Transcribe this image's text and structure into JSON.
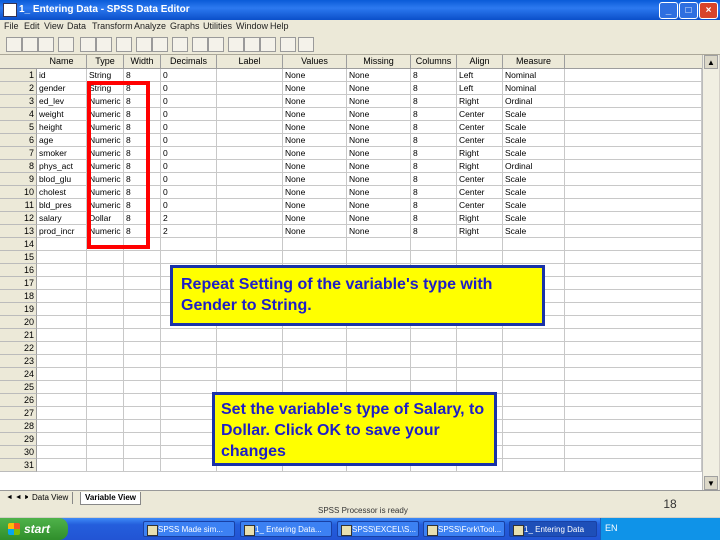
{
  "window": {
    "title": "1_ Entering Data - SPSS Data Editor"
  },
  "menu": [
    "File",
    "Edit",
    "View",
    "Data",
    "Transform",
    "Analyze",
    "Graphs",
    "Utilities",
    "Window",
    "Help"
  ],
  "grid": {
    "columns": [
      "Name",
      "Type",
      "Width",
      "Decimals",
      "Label",
      "Values",
      "Missing",
      "Columns",
      "Align",
      "Measure"
    ],
    "rows": [
      [
        "id",
        "String",
        "8",
        "0",
        "",
        "None",
        "None",
        "8",
        "Left",
        "Nominal"
      ],
      [
        "gender",
        "String",
        "8",
        "0",
        "",
        "None",
        "None",
        "8",
        "Left",
        "Nominal"
      ],
      [
        "ed_lev",
        "Numeric",
        "8",
        "0",
        "",
        "None",
        "None",
        "8",
        "Right",
        "Ordinal"
      ],
      [
        "weight",
        "Numeric",
        "8",
        "0",
        "",
        "None",
        "None",
        "8",
        "Center",
        "Scale"
      ],
      [
        "height",
        "Numeric",
        "8",
        "0",
        "",
        "None",
        "None",
        "8",
        "Center",
        "Scale"
      ],
      [
        "age",
        "Numeric",
        "8",
        "0",
        "",
        "None",
        "None",
        "8",
        "Center",
        "Scale"
      ],
      [
        "smoker",
        "Numeric",
        "8",
        "0",
        "",
        "None",
        "None",
        "8",
        "Right",
        "Scale"
      ],
      [
        "phys_act",
        "Numeric",
        "8",
        "0",
        "",
        "None",
        "None",
        "8",
        "Right",
        "Ordinal"
      ],
      [
        "blod_glu",
        "Numeric",
        "8",
        "0",
        "",
        "None",
        "None",
        "8",
        "Center",
        "Scale"
      ],
      [
        "cholest",
        "Numeric",
        "8",
        "0",
        "",
        "None",
        "None",
        "8",
        "Center",
        "Scale"
      ],
      [
        "bld_pres",
        "Numeric",
        "8",
        "0",
        "",
        "None",
        "None",
        "8",
        "Center",
        "Scale"
      ],
      [
        "salary",
        "Dollar",
        "8",
        "2",
        "",
        "None",
        "None",
        "8",
        "Right",
        "Scale"
      ],
      [
        "prod_incr",
        "Numeric",
        "8",
        "2",
        "",
        "None",
        "None",
        "8",
        "Right",
        "Scale"
      ]
    ],
    "row_numbers": [
      "1",
      "2",
      "3",
      "4",
      "5",
      "6",
      "7",
      "8",
      "9",
      "10",
      "11",
      "12",
      "13",
      "14",
      "15",
      "16",
      "17",
      "18",
      "19",
      "20",
      "21",
      "22",
      "23",
      "24",
      "25",
      "26",
      "27",
      "28",
      "29",
      "30",
      "31"
    ]
  },
  "tabs": {
    "data_view": "Data View",
    "variable_view": "Variable View"
  },
  "status": {
    "processor": "SPSS Processor  is ready"
  },
  "taskbar": {
    "start": "start",
    "tasks": [
      "SPSS Made sim...",
      "1_ Entering Data...",
      "SPSS\\EXCEL\\S...",
      "SPSS\\Fork\\Tool...",
      "1_ Entering Data"
    ],
    "lang": "EN"
  },
  "callouts": {
    "first": "Repeat Setting of the variable's type with Gender to String.",
    "second": "Set the variable's type of Salary,  to Dollar. Click OK to save your changes"
  },
  "slide_number": "18"
}
